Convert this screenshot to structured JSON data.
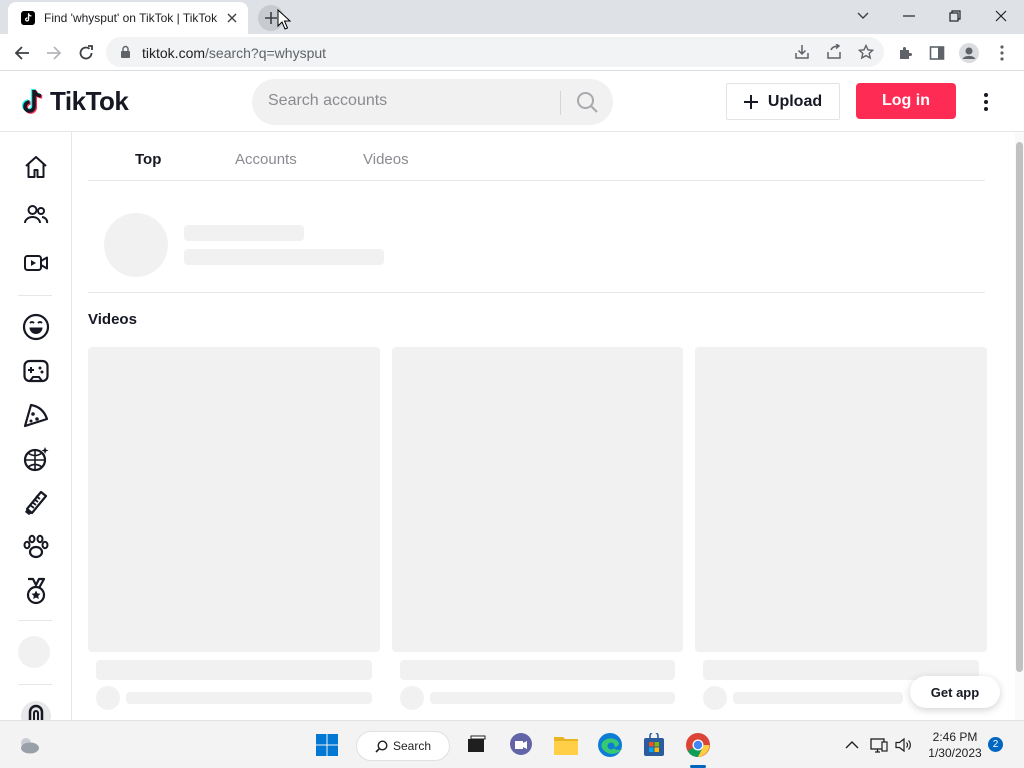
{
  "browser": {
    "tab_title": "Find 'whysput' on TikTok | TikTok",
    "url_host": "tiktok.com",
    "url_path": "/search?q=whysput"
  },
  "header": {
    "logo_text": "TikTok",
    "search_placeholder": "Search accounts",
    "upload_label": "Upload",
    "login_label": "Log in"
  },
  "sidebar": {
    "items": [
      "home-icon",
      "following-icon",
      "live-icon",
      "comedy-icon",
      "gaming-icon",
      "food-icon",
      "dance-icon",
      "beauty-icon",
      "animals-icon",
      "sports-icon"
    ]
  },
  "results": {
    "tabs": [
      "Top",
      "Accounts",
      "Videos"
    ],
    "active_tab": "Top",
    "videos_heading": "Videos"
  },
  "get_app_label": "Get app",
  "taskbar": {
    "search_label": "Search",
    "time": "2:46 PM",
    "date": "1/30/2023",
    "notification_count": "2"
  },
  "colors": {
    "brand_red": "#fe2c55",
    "skeleton": "#f1f1f2",
    "tab_strip": "#dee1e6"
  }
}
